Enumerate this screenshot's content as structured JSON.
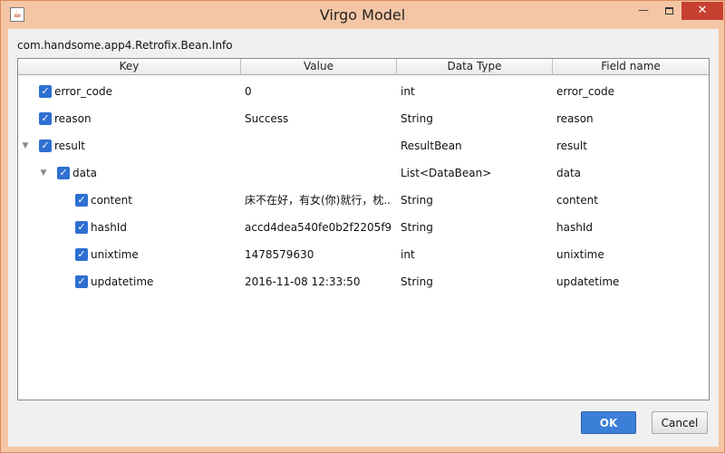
{
  "window": {
    "title": "Virgo Model",
    "minimize_symbol": "—",
    "close_symbol": "✕",
    "accent_color": "#f4c6a5",
    "close_color": "#c7402f"
  },
  "class_name": "com.handsome.app4.Retrofix.Bean.Info",
  "table": {
    "columns": [
      "Key",
      "Value",
      "Data Type",
      "Field name"
    ],
    "rows": [
      {
        "key": "error_code",
        "value": "0",
        "type": "int",
        "field": "error_code",
        "checked": true,
        "level": 0,
        "toggle": ""
      },
      {
        "key": "reason",
        "value": "Success",
        "type": "String",
        "field": "reason",
        "checked": true,
        "level": 0,
        "toggle": ""
      },
      {
        "key": "result",
        "value": "",
        "type": "ResultBean",
        "field": "result",
        "checked": true,
        "level": 0,
        "toggle": "▼"
      },
      {
        "key": "data",
        "value": "",
        "type": "List<DataBean>",
        "field": "data",
        "checked": true,
        "level": 1,
        "toggle": "▼"
      },
      {
        "key": "content",
        "value": "床不在好，有女(你)就行，枕...",
        "type": "String",
        "field": "content",
        "checked": true,
        "level": 2,
        "toggle": ""
      },
      {
        "key": "hashId",
        "value": "accd4dea540fe0b2f2205f9...",
        "type": "String",
        "field": "hashId",
        "checked": true,
        "level": 2,
        "toggle": ""
      },
      {
        "key": "unixtime",
        "value": "1478579630",
        "type": "int",
        "field": "unixtime",
        "checked": true,
        "level": 2,
        "toggle": ""
      },
      {
        "key": "updatetime",
        "value": "2016-11-08 12:33:50",
        "type": "String",
        "field": "updatetime",
        "checked": true,
        "level": 2,
        "toggle": ""
      }
    ]
  },
  "buttons": {
    "ok_label": "OK",
    "cancel_label": "Cancel"
  }
}
